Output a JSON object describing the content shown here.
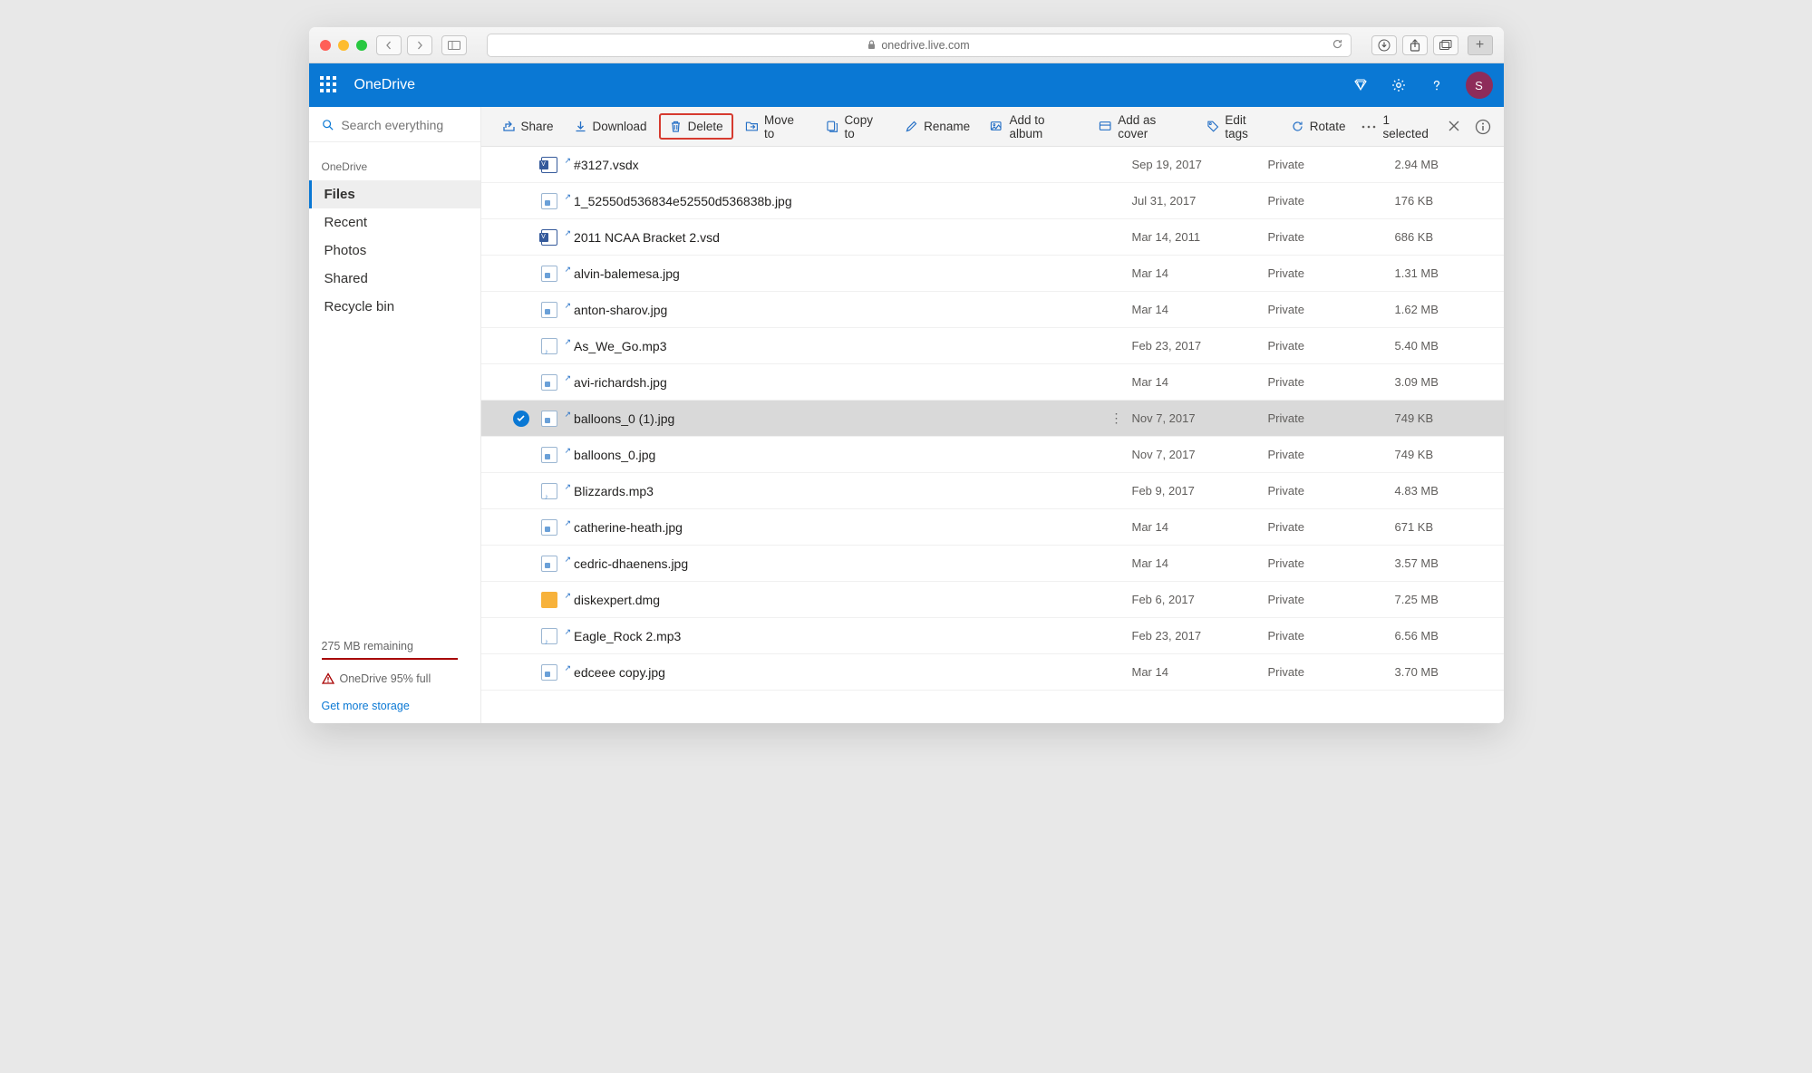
{
  "browser": {
    "url": "onedrive.live.com"
  },
  "header": {
    "brand": "OneDrive",
    "avatar_initial": "S"
  },
  "sidebar": {
    "search_placeholder": "Search everything",
    "heading": "OneDrive",
    "items": [
      {
        "label": "Files",
        "active": true
      },
      {
        "label": "Recent"
      },
      {
        "label": "Photos"
      },
      {
        "label": "Shared"
      },
      {
        "label": "Recycle bin"
      }
    ],
    "remaining": "275 MB remaining",
    "full_warning": "OneDrive 95% full",
    "get_storage": "Get more storage"
  },
  "commands": {
    "share": "Share",
    "download": "Download",
    "delete": "Delete",
    "move": "Move to",
    "copy": "Copy to",
    "rename": "Rename",
    "add_album": "Add to album",
    "add_cover": "Add as cover",
    "edit_tags": "Edit tags",
    "rotate": "Rotate",
    "selected_text": "1 selected"
  },
  "files": [
    {
      "icon": "vsd",
      "name": "#3127.vsdx",
      "date": "Sep 19, 2017",
      "share": "Private",
      "size": "2.94 MB"
    },
    {
      "icon": "img",
      "name": "1_52550d536834e52550d536838b.jpg",
      "date": "Jul 31, 2017",
      "share": "Private",
      "size": "176 KB"
    },
    {
      "icon": "vsd",
      "name": "2011 NCAA Bracket 2.vsd",
      "date": "Mar 14, 2011",
      "share": "Private",
      "size": "686 KB"
    },
    {
      "icon": "img",
      "name": "alvin-balemesa.jpg",
      "date": "Mar 14",
      "share": "Private",
      "size": "1.31 MB"
    },
    {
      "icon": "img",
      "name": "anton-sharov.jpg",
      "date": "Mar 14",
      "share": "Private",
      "size": "1.62 MB"
    },
    {
      "icon": "mp3",
      "name": "As_We_Go.mp3",
      "date": "Feb 23, 2017",
      "share": "Private",
      "size": "5.40 MB"
    },
    {
      "icon": "img",
      "name": "avi-richardsh.jpg",
      "date": "Mar 14",
      "share": "Private",
      "size": "3.09 MB"
    },
    {
      "icon": "img",
      "name": "balloons_0 (1).jpg",
      "date": "Nov 7, 2017",
      "share": "Private",
      "size": "749 KB",
      "selected": true
    },
    {
      "icon": "img",
      "name": "balloons_0.jpg",
      "date": "Nov 7, 2017",
      "share": "Private",
      "size": "749 KB"
    },
    {
      "icon": "mp3",
      "name": "Blizzards.mp3",
      "date": "Feb 9, 2017",
      "share": "Private",
      "size": "4.83 MB"
    },
    {
      "icon": "img",
      "name": "catherine-heath.jpg",
      "date": "Mar 14",
      "share": "Private",
      "size": "671 KB"
    },
    {
      "icon": "img",
      "name": "cedric-dhaenens.jpg",
      "date": "Mar 14",
      "share": "Private",
      "size": "3.57 MB"
    },
    {
      "icon": "dmg",
      "name": "diskexpert.dmg",
      "date": "Feb 6, 2017",
      "share": "Private",
      "size": "7.25 MB"
    },
    {
      "icon": "mp3",
      "name": "Eagle_Rock 2.mp3",
      "date": "Feb 23, 2017",
      "share": "Private",
      "size": "6.56 MB"
    },
    {
      "icon": "img",
      "name": "edceee copy.jpg",
      "date": "Mar 14",
      "share": "Private",
      "size": "3.70 MB"
    }
  ]
}
